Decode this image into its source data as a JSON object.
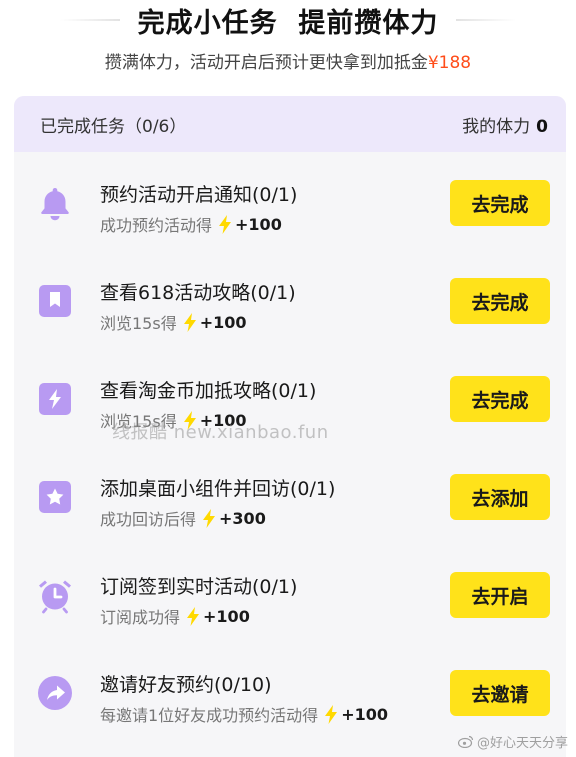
{
  "header": {
    "title": "完成小任务  提前攒体力",
    "subtitle_prefix": "攒满体力，活动开启后预计更快拿到加抵金",
    "subtitle_amount": "¥188"
  },
  "panel": {
    "completed_label": "已完成任务（0/6）",
    "energy_label": "我的体力",
    "energy_value": "0"
  },
  "tasks": [
    {
      "name": "预约活动开启通知(0/1)",
      "desc": "成功预约活动得",
      "reward": "+100",
      "button": "去完成",
      "icon": "bell-icon"
    },
    {
      "name": "查看618活动攻略(0/1)",
      "desc": "浏览15s得",
      "reward": "+100",
      "button": "去完成",
      "icon": "bookmark-icon"
    },
    {
      "name": "查看淘金币加抵攻略(0/1)",
      "desc": "浏览15s得",
      "reward": "+100",
      "button": "去完成",
      "icon": "lightning-icon"
    },
    {
      "name": "添加桌面小组件并回访(0/1)",
      "desc": "成功回访后得",
      "reward": "+300",
      "button": "去添加",
      "icon": "star-icon"
    },
    {
      "name": "订阅签到实时活动(0/1)",
      "desc": "订阅成功得",
      "reward": "+100",
      "button": "去开启",
      "icon": "alarm-clock-icon"
    },
    {
      "name": "邀请好友预约(0/10)",
      "desc": "每邀请1位好友成功预约活动得",
      "reward": "+100",
      "button": "去邀请",
      "icon": "share-icon"
    }
  ],
  "watermark": "线报酷 new.xianbao.fun",
  "credit": "@好心天天分享",
  "colors": {
    "accent_purple": "#b89af2",
    "button_yellow": "#ffe21a",
    "amount_red": "#ff4d1a",
    "header_bg": "#ede8fb"
  }
}
